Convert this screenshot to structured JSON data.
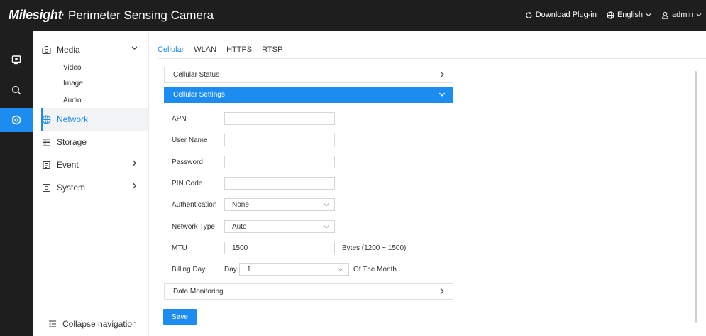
{
  "header": {
    "brand": "Milesight",
    "separator": "·",
    "title": "Perimeter Sensing Camera",
    "download_plugin": "Download Plug-in",
    "language": "English",
    "user": "admin"
  },
  "rail": {
    "items": [
      {
        "icon": "live-view-icon"
      },
      {
        "icon": "search-icon"
      },
      {
        "icon": "settings-icon"
      }
    ]
  },
  "sidebar": {
    "media": "Media",
    "media_sub": [
      "Video",
      "Image",
      "Audio"
    ],
    "network": "Network",
    "storage": "Storage",
    "event": "Event",
    "system": "System",
    "collapse": "Collapse navigation"
  },
  "tabs": [
    "Cellular",
    "WLAN",
    "HTTPS",
    "RTSP"
  ],
  "active_tab": "Cellular",
  "panels": {
    "status": "Cellular Status",
    "settings": "Cellular Settings",
    "monitoring": "Data Monitoring"
  },
  "form": {
    "apn": {
      "label": "APN",
      "value": ""
    },
    "user_name": {
      "label": "User Name",
      "value": ""
    },
    "password": {
      "label": "Password",
      "value": ""
    },
    "pin_code": {
      "label": "PIN Code",
      "value": ""
    },
    "authentication": {
      "label": "Authentication",
      "value": "None"
    },
    "network_type": {
      "label": "Network Type",
      "value": "Auto"
    },
    "mtu": {
      "label": "MTU",
      "value": "1500",
      "hint": "Bytes (1200 ~ 1500)"
    },
    "billing_day": {
      "label": "Billing Day",
      "prefix": "Day",
      "value": "1",
      "suffix": "Of The Month"
    }
  },
  "save_label": "Save",
  "colors": {
    "accent": "#1d8cf0",
    "topbar": "#1e1e1e"
  }
}
